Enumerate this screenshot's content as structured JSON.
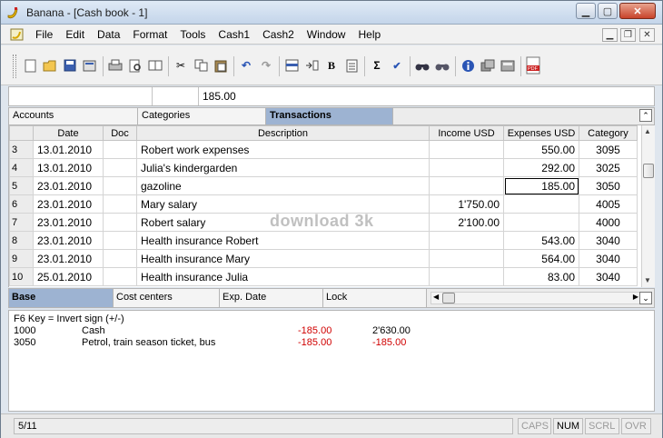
{
  "window": {
    "title": "Banana - [Cash book - 1]"
  },
  "menu": [
    "File",
    "Edit",
    "Data",
    "Format",
    "Tools",
    "Cash1",
    "Cash2",
    "Window",
    "Help"
  ],
  "toolbar_icons": [
    "new-icon",
    "open-icon",
    "save-icon",
    "properties-icon",
    "print-icon",
    "print-preview-icon",
    "book-icon",
    "cut-icon",
    "copy-icon",
    "paste-icon",
    "undo-icon",
    "redo-icon",
    "insert-row-icon",
    "indent-icon",
    "bold-icon",
    "format-icon",
    "sum-icon",
    "check-icon",
    "find-icon",
    "replace-icon",
    "info-icon",
    "windows-icon",
    "tile-icon",
    "pdf-icon"
  ],
  "formula_bar": {
    "value": "185.00"
  },
  "top_tabs": [
    "Accounts",
    "Categories",
    "Transactions"
  ],
  "table": {
    "headers": [
      "Date",
      "Doc",
      "Description",
      "Income USD",
      "Expenses USD",
      "Category"
    ],
    "rows": [
      {
        "n": "3",
        "date": "13.01.2010",
        "doc": "",
        "desc": "Robert work expenses",
        "income": "",
        "expenses": "550.00",
        "cat": "3095"
      },
      {
        "n": "4",
        "date": "13.01.2010",
        "doc": "",
        "desc": "Julia's kindergarden",
        "income": "",
        "expenses": "292.00",
        "cat": "3025"
      },
      {
        "n": "5",
        "date": "23.01.2010",
        "doc": "",
        "desc": "gazoline",
        "income": "",
        "expenses": "185.00",
        "cat": "3050"
      },
      {
        "n": "6",
        "date": "23.01.2010",
        "doc": "",
        "desc": "Mary salary",
        "income": "1'750.00",
        "expenses": "",
        "cat": "4005"
      },
      {
        "n": "7",
        "date": "23.01.2010",
        "doc": "",
        "desc": "Robert salary",
        "income": "2'100.00",
        "expenses": "",
        "cat": "4000"
      },
      {
        "n": "8",
        "date": "23.01.2010",
        "doc": "",
        "desc": "Health insurance Robert",
        "income": "",
        "expenses": "543.00",
        "cat": "3040"
      },
      {
        "n": "9",
        "date": "23.01.2010",
        "doc": "",
        "desc": "Health insurance Mary",
        "income": "",
        "expenses": "564.00",
        "cat": "3040"
      },
      {
        "n": "10",
        "date": "25.01.2010",
        "doc": "",
        "desc": "Health insurance Julia",
        "income": "",
        "expenses": "83.00",
        "cat": "3040"
      }
    ]
  },
  "watermark": "download 3k",
  "bottom_tabs": [
    "Base",
    "Cost centers",
    "Exp. Date",
    "Lock"
  ],
  "info": {
    "hint": "F6 Key = Invert sign (+/-)",
    "lines": [
      {
        "account": "1000",
        "name": "Cash",
        "amount": "-185.00",
        "balance": "2'630.00",
        "balance_red": false
      },
      {
        "account": "3050",
        "name": "Petrol, train season ticket, bus",
        "amount": "-185.00",
        "balance": "-185.00",
        "balance_red": true
      }
    ]
  },
  "status": {
    "record": "5/11",
    "indicators": [
      "CAPS",
      "NUM",
      "SCRL",
      "OVR"
    ],
    "active_indicator": "NUM"
  },
  "colors": {
    "active_tab": "#9db3d2",
    "negative": "#d00000"
  }
}
